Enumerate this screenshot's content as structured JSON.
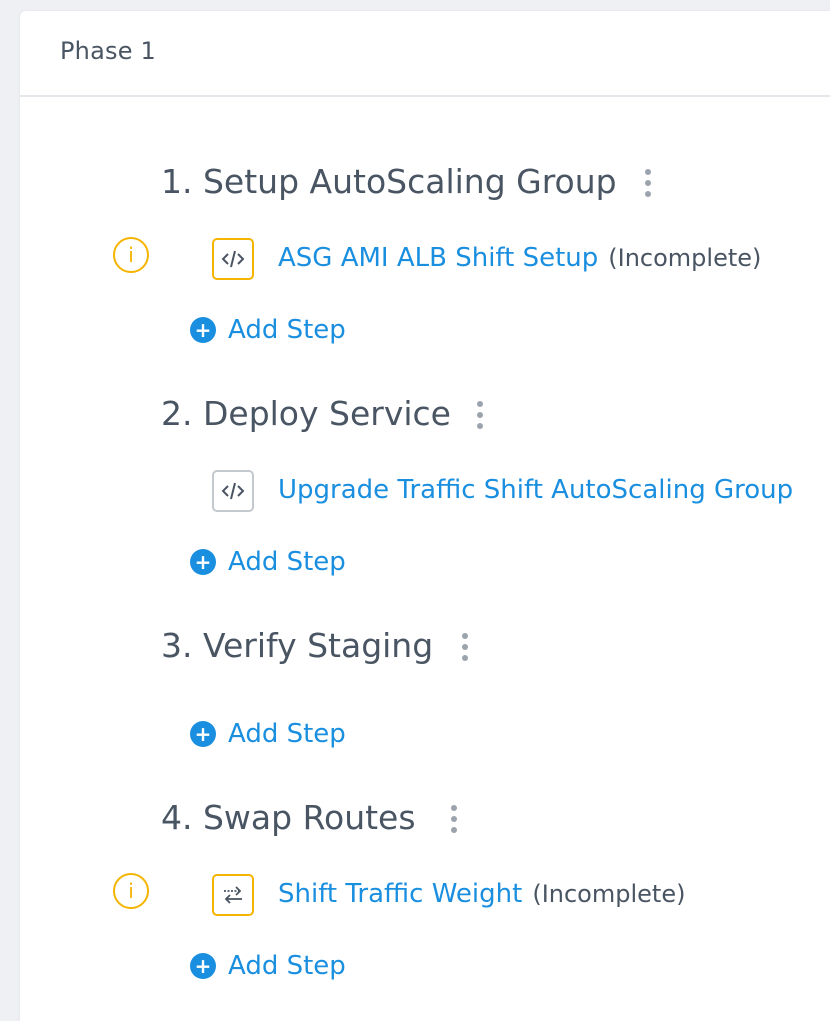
{
  "phase": {
    "title": "Phase 1"
  },
  "sections": [
    {
      "title": "1. Setup AutoScaling Group",
      "steps": [
        {
          "name": "ASG AMI ALB Shift Setup",
          "status": "(Incomplete)",
          "icon": "code-icon",
          "warning": true
        }
      ],
      "add_step_label": "Add Step"
    },
    {
      "title": "2. Deploy Service",
      "steps": [
        {
          "name": "Upgrade Traffic Shift AutoScaling Group",
          "status": "",
          "icon": "code-icon",
          "warning": false
        }
      ],
      "add_step_label": "Add Step"
    },
    {
      "title": "3. Verify Staging",
      "steps": [],
      "add_step_label": "Add Step"
    },
    {
      "title": "4. Swap Routes",
      "steps": [
        {
          "name": "Shift Traffic Weight",
          "status": "(Incomplete)",
          "icon": "swap-arrows-icon",
          "warning": true
        }
      ],
      "add_step_label": "Add Step"
    }
  ],
  "icons": {
    "info": "i",
    "add": "+"
  },
  "colors": {
    "accent": "#1a8fe0",
    "warning": "#f5b400",
    "text": "#4a5563",
    "muted": "#9ba3ad"
  }
}
